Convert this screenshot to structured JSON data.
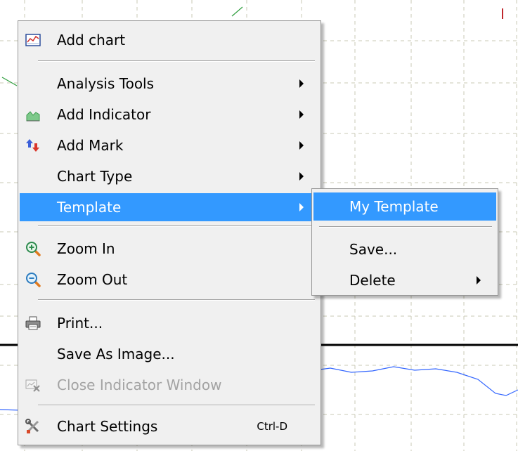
{
  "chart": {
    "gridline_color": "#c8c8b4",
    "line_color": "#3366ff",
    "axis_color": "#000000"
  },
  "context_menu": {
    "items": [
      {
        "label": "Add chart",
        "icon": "add-chart-icon"
      },
      {
        "label": "Analysis Tools",
        "has_submenu": true
      },
      {
        "label": "Add Indicator",
        "icon": "indicator-chart-icon",
        "has_submenu": true
      },
      {
        "label": "Add Mark",
        "icon": "add-mark-arrows-icon",
        "has_submenu": true
      },
      {
        "label": "Chart Type",
        "has_submenu": true
      },
      {
        "label": "Template",
        "has_submenu": true,
        "selected": true
      },
      {
        "label": "Zoom In",
        "icon": "zoom-in-icon"
      },
      {
        "label": "Zoom Out",
        "icon": "zoom-out-icon"
      },
      {
        "label": "Print...",
        "icon": "printer-icon"
      },
      {
        "label": "Save As Image..."
      },
      {
        "label": "Close Indicator Window",
        "icon": "close-indicator-icon",
        "disabled": true
      },
      {
        "label": "Chart Settings",
        "icon": "tools-icon",
        "shortcut": "Ctrl-D"
      }
    ]
  },
  "template_submenu": {
    "items": [
      {
        "label": "My Template",
        "selected": true
      },
      {
        "label": "Save..."
      },
      {
        "label": "Delete",
        "has_submenu": true
      }
    ]
  },
  "colors": {
    "selection": "#3399ff",
    "menu_background": "#f0f0f0",
    "disabled_text": "#a3a3a3"
  }
}
